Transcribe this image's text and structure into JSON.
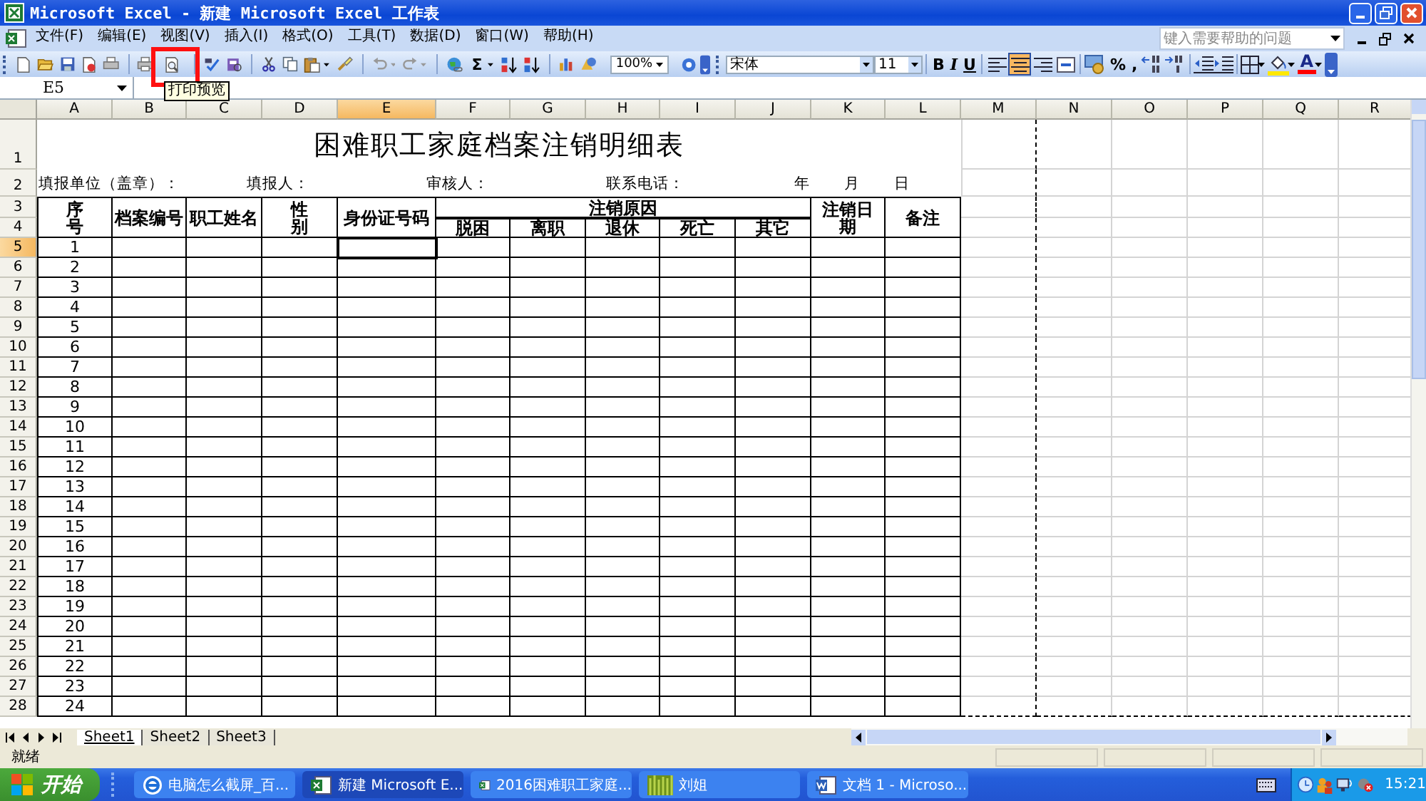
{
  "window": {
    "title": "Microsoft Excel - 新建 Microsoft Excel 工作表"
  },
  "menu": [
    "文件(F)",
    "编辑(E)",
    "视图(V)",
    "插入(I)",
    "格式(O)",
    "工具(T)",
    "数据(D)",
    "窗口(W)",
    "帮助(H)"
  ],
  "help_box": {
    "placeholder": "键入需要帮助的问题"
  },
  "standard_toolbar": {
    "autosum": "Σ",
    "zoom": "100%"
  },
  "tooltip": "打印预览",
  "formatting_toolbar": {
    "font": "宋体",
    "size": "11",
    "styles": [
      "B",
      "I",
      "U"
    ],
    "align": [
      {
        "selected": false
      },
      {
        "selected": true
      },
      {
        "selected": false
      },
      {
        "selected": false
      }
    ],
    "percent": "%",
    "comma": ",",
    "font_color": "A"
  },
  "name_box": "E5",
  "columns": [
    {
      "label": "A",
      "selected": false
    },
    {
      "label": "B",
      "selected": false
    },
    {
      "label": "C",
      "selected": false
    },
    {
      "label": "D",
      "selected": false
    },
    {
      "label": "E",
      "selected": true
    },
    {
      "label": "F",
      "selected": false
    },
    {
      "label": "G",
      "selected": false
    },
    {
      "label": "H",
      "selected": false
    },
    {
      "label": "I",
      "selected": false
    },
    {
      "label": "J",
      "selected": false
    },
    {
      "label": "K",
      "selected": false
    },
    {
      "label": "L",
      "selected": false
    },
    {
      "label": "M",
      "selected": false
    },
    {
      "label": "N",
      "selected": false
    },
    {
      "label": "O",
      "selected": false
    },
    {
      "label": "P",
      "selected": false
    },
    {
      "label": "Q",
      "selected": false
    },
    {
      "label": "R",
      "selected": false
    }
  ],
  "row_numbers": [
    {
      "label": "1",
      "selected": false
    },
    {
      "label": "2",
      "selected": false
    },
    {
      "label": "3",
      "selected": false
    },
    {
      "label": "4",
      "selected": false
    },
    {
      "label": "5",
      "selected": true
    },
    {
      "label": "6",
      "selected": false
    },
    {
      "label": "7",
      "selected": false
    },
    {
      "label": "8",
      "selected": false
    },
    {
      "label": "9",
      "selected": false
    },
    {
      "label": "10",
      "selected": false
    },
    {
      "label": "11",
      "selected": false
    },
    {
      "label": "12",
      "selected": false
    },
    {
      "label": "13",
      "selected": false
    },
    {
      "label": "14",
      "selected": false
    },
    {
      "label": "15",
      "selected": false
    },
    {
      "label": "16",
      "selected": false
    },
    {
      "label": "17",
      "selected": false
    },
    {
      "label": "18",
      "selected": false
    },
    {
      "label": "19",
      "selected": false
    },
    {
      "label": "20",
      "selected": false
    },
    {
      "label": "21",
      "selected": false
    },
    {
      "label": "22",
      "selected": false
    },
    {
      "label": "23",
      "selected": false
    },
    {
      "label": "24",
      "selected": false
    },
    {
      "label": "25",
      "selected": false
    },
    {
      "label": "26",
      "selected": false
    },
    {
      "label": "27",
      "selected": false
    },
    {
      "label": "28",
      "selected": false
    }
  ],
  "sheet": {
    "title": "困难职工家庭档案注销明细表",
    "info": [
      "填报单位（盖章）：",
      "填报人：",
      "审核人：",
      "联系电话：",
      "年",
      "月",
      "日"
    ],
    "headers": [
      {
        "lines": [
          "序",
          "号"
        ]
      },
      {
        "lines": [
          "档案编号"
        ]
      },
      {
        "lines": [
          "职工姓名"
        ]
      },
      {
        "lines": [
          "性",
          "别"
        ]
      },
      {
        "lines": [
          "身份证号码"
        ]
      },
      {
        "lines": [
          "注销原因"
        ],
        "sub": [
          "脱困",
          "离职",
          "退休",
          "死亡",
          "其它"
        ]
      },
      {
        "lines": [
          "注销日",
          "期"
        ]
      },
      {
        "lines": [
          "备注"
        ]
      }
    ],
    "serials": [
      "1",
      "2",
      "3",
      "4",
      "5",
      "6",
      "7",
      "8",
      "9",
      "10",
      "11",
      "12",
      "13",
      "14",
      "15",
      "16",
      "17",
      "18",
      "19",
      "20",
      "21",
      "22",
      "23",
      "24"
    ]
  },
  "sheet_tabs": [
    {
      "label": "Sheet1",
      "selected": true
    },
    {
      "label": "Sheet2",
      "selected": false
    },
    {
      "label": "Sheet3",
      "selected": false
    }
  ],
  "status_bar": "就绪",
  "taskbar": {
    "start": "开始",
    "tasks": [
      {
        "kind": "browser",
        "label": "电脑怎么截屏_百...",
        "selected": false
      },
      {
        "kind": "excel",
        "label": "新建 Microsoft E...",
        "selected": true
      },
      {
        "kind": "excel",
        "label": "2016困难职工家庭...",
        "selected": false
      },
      {
        "kind": "picture",
        "label": "刘姐",
        "selected": false
      },
      {
        "kind": "word",
        "label": "文档 1 - Microso...",
        "selected": false
      }
    ],
    "clock": "15:21"
  }
}
